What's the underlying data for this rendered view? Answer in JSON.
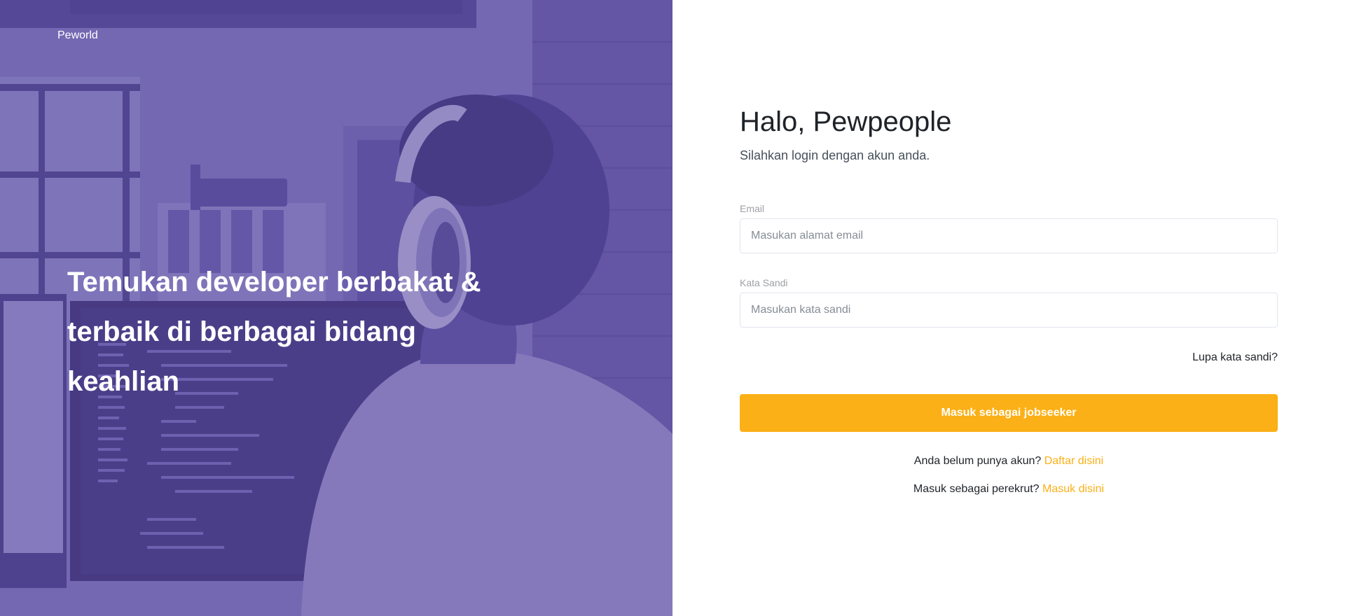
{
  "hero": {
    "brand": "Peworld",
    "headline": "Temukan developer berbakat & terbaik di berbagai bidang keahlian"
  },
  "login": {
    "greeting": "Halo, Pewpeople",
    "subtitle": "Silahkan login dengan akun anda.",
    "email": {
      "label": "Email",
      "placeholder": "Masukan alamat email",
      "value": ""
    },
    "password": {
      "label": "Kata Sandi",
      "placeholder": "Masukan kata sandi",
      "value": ""
    },
    "forgot_link": "Lupa kata sandi?",
    "submit_label": "Masuk sebagai jobseeker",
    "register_prompt": "Anda belum punya akun?",
    "register_link": "Daftar disini",
    "recruiter_prompt": "Masuk sebagai perekrut?",
    "recruiter_link": "Masuk disini"
  },
  "colors": {
    "accent": "#fbb017",
    "hero_overlay": "#5e50a1"
  }
}
